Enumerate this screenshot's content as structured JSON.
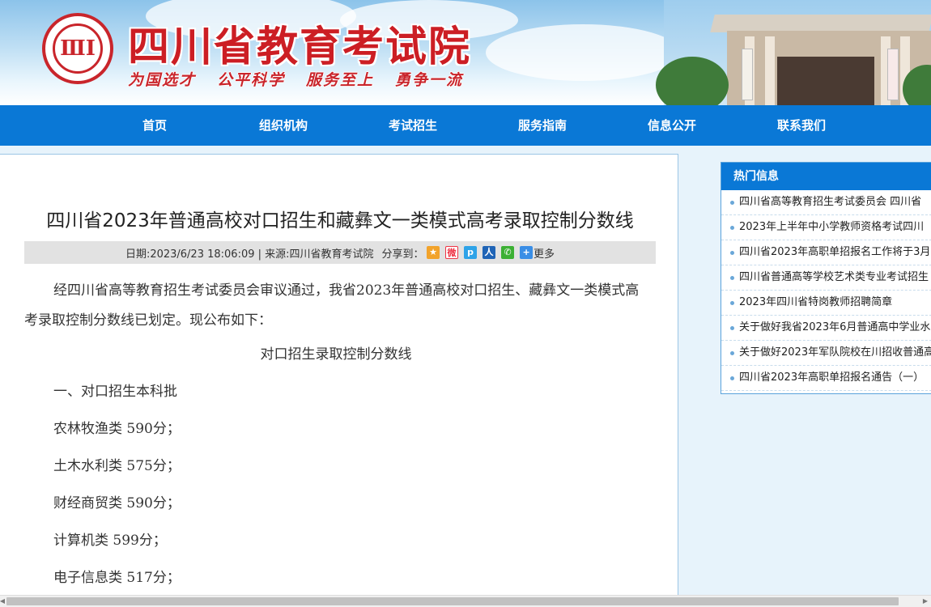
{
  "header": {
    "site_title": "四川省教育考试院",
    "logo_text": "ⅢⅠ",
    "slogans": [
      "为国选才",
      "公平科学",
      "服务至上",
      "勇争一流"
    ]
  },
  "nav": {
    "items": [
      "首页",
      "组织机构",
      "考试招生",
      "服务指南",
      "信息公开",
      "联系我们"
    ]
  },
  "article": {
    "title": "四川省2023年普通高校对口招生和藏彝文一类模式高考录取控制分数线",
    "meta": "日期:2023/6/23 18:06:09 | 来源:四川省教育考试院",
    "share_label": "分享到：",
    "share_icons": [
      "qzone-icon",
      "weibo-icon",
      "tencent-weibo-icon",
      "renren-icon",
      "wechat-icon"
    ],
    "more_label": "更多",
    "intro": "经四川省高等教育招生考试委员会审议通过，我省2023年普通高校对口招生、藏彝文一类模式高考录取控制分数线已划定。现公布如下：",
    "subheading": "对口招生录取控制分数线",
    "section": "一、对口招生本科批",
    "lines": [
      "农林牧渔类  590分；",
      "土木水利类  575分；",
      "财经商贸类  590分；",
      "计算机类  599分；",
      "电子信息类  517分；"
    ]
  },
  "sidebar": {
    "heading": "热门信息",
    "items": [
      "四川省高等教育招生考试委员会 四川省",
      "2023年上半年中小学教师资格考试四川",
      "四川省2023年高职单招报名工作将于3月",
      "四川省普通高等学校艺术类专业考试招生",
      "2023年四川省特岗教师招聘简章",
      "关于做好我省2023年6月普通高中学业水平",
      "关于做好2023年军队院校在川招收普通高",
      "四川省2023年高职单招报名通告（一）"
    ]
  },
  "colors": {
    "nav_blue": "#0a78d6",
    "title_red": "#cc1e24",
    "page_bg": "#e7f3fb"
  }
}
